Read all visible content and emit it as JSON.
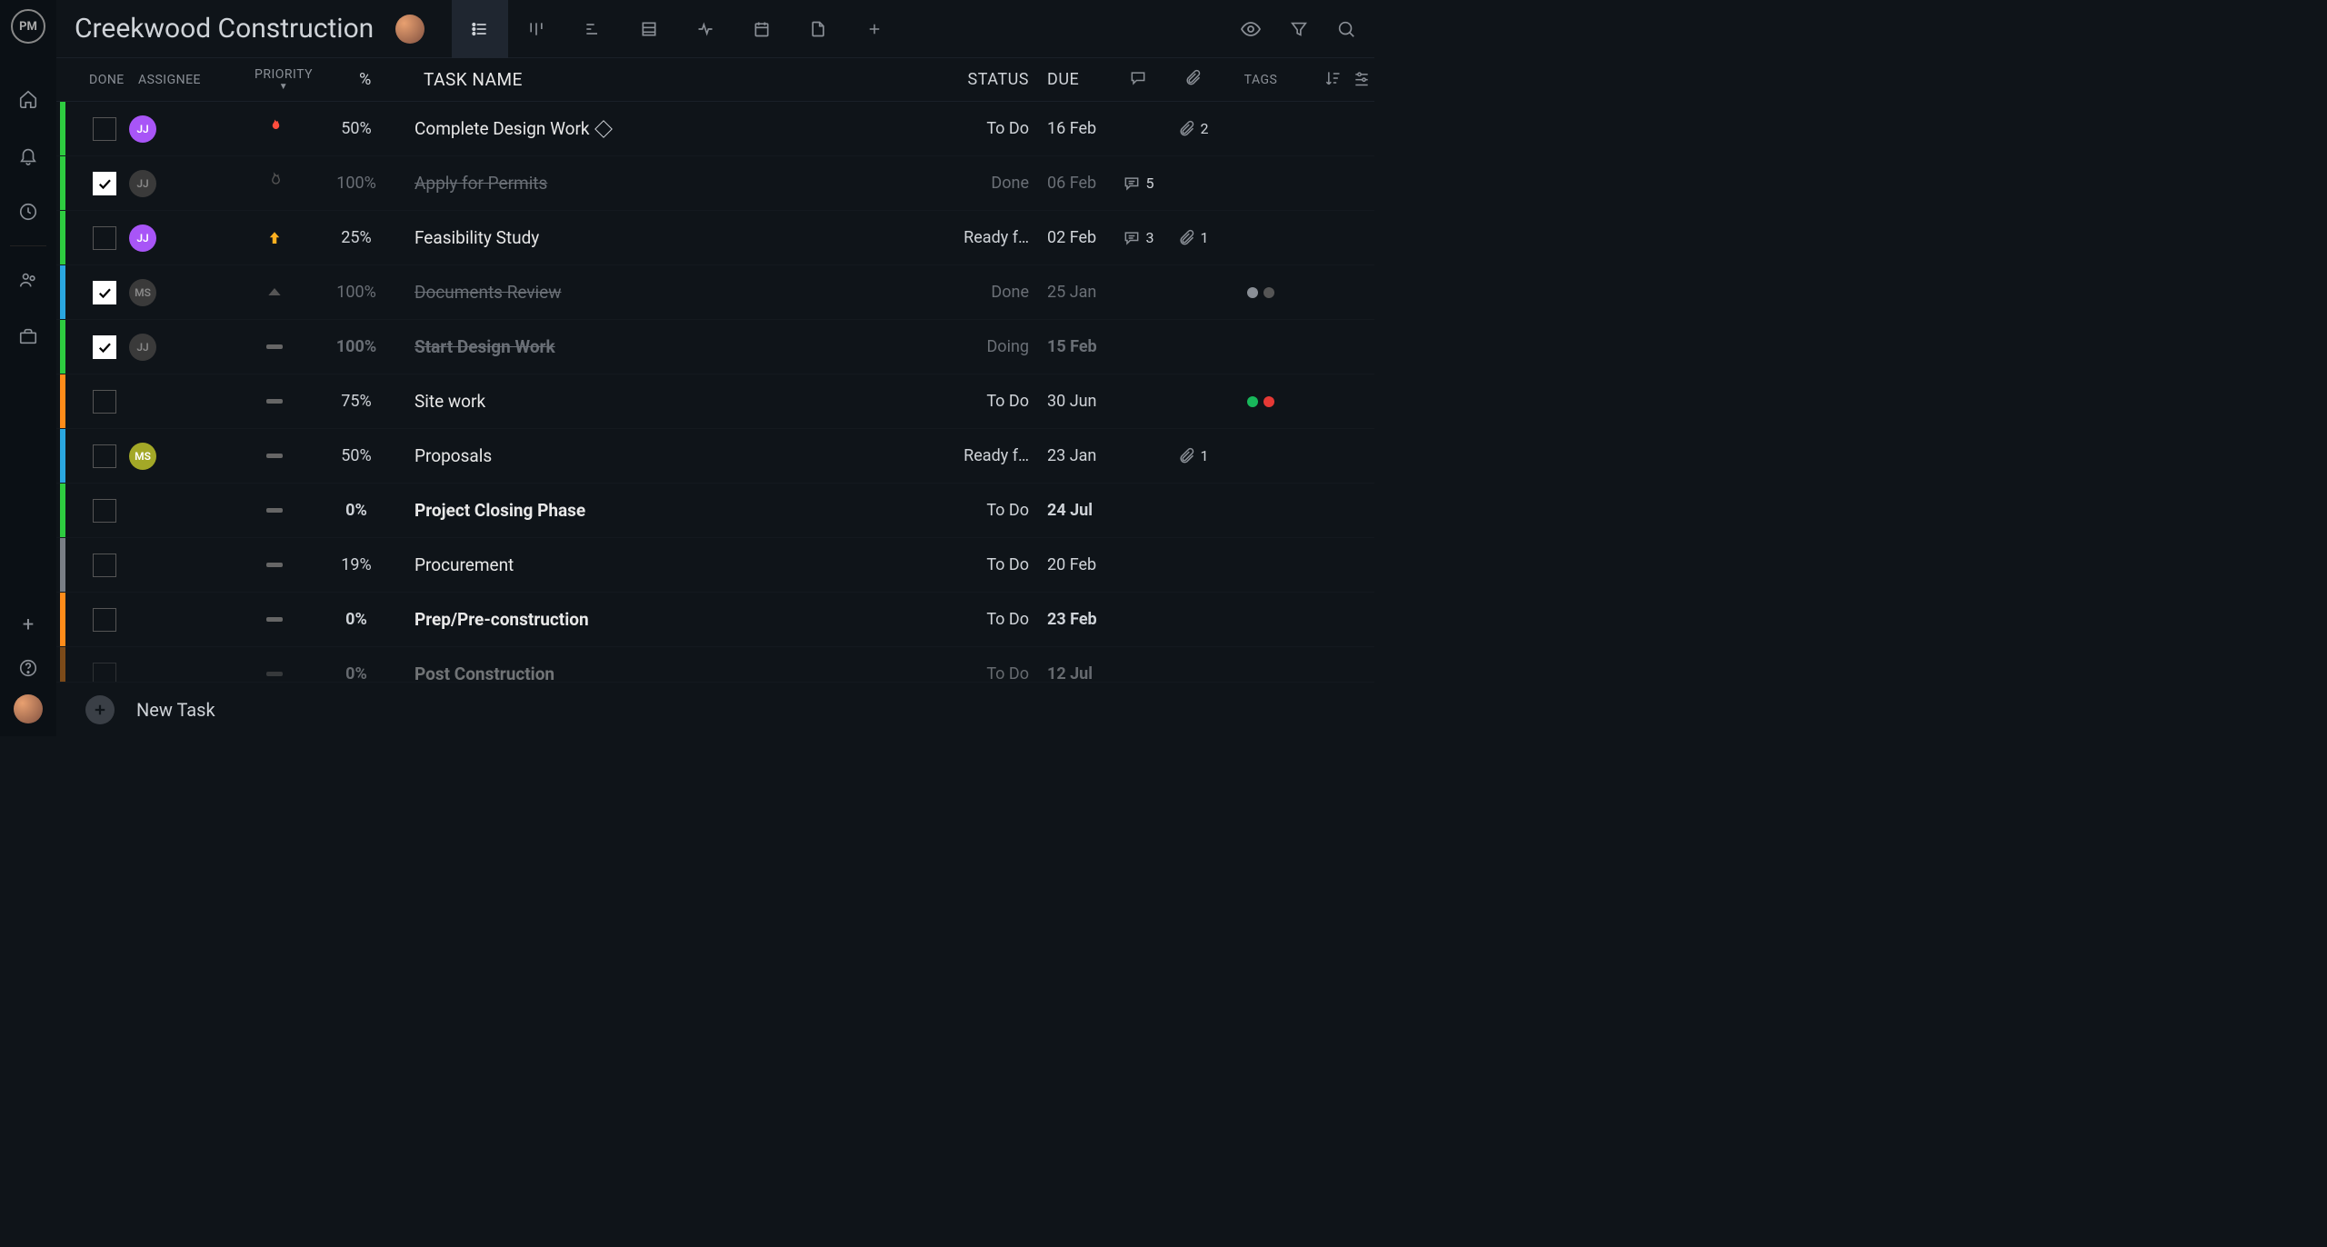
{
  "app": {
    "logo_text": "PM"
  },
  "header": {
    "title": "Creekwood Construction"
  },
  "columns": {
    "done": "DONE",
    "assignee": "ASSIGNEE",
    "priority": "PRIORITY",
    "percent": "%",
    "task_name": "TASK NAME",
    "status": "STATUS",
    "due": "DUE",
    "tags": "TAGS"
  },
  "footer": {
    "new_task": "New Task"
  },
  "stripe_colors": {
    "green": "#2ecc40",
    "blue": "#2aa7e0",
    "orange": "#ff8c1a",
    "grey": "#7a7f86"
  },
  "tasks": [
    {
      "stripe": "green",
      "done": false,
      "assignee": "JJ",
      "assignee_style": "jj",
      "priority": "flame",
      "percent": "50%",
      "name": "Complete Design Work",
      "diamond": true,
      "status": "To Do",
      "due": "16 Feb",
      "comments": null,
      "attachments": "2",
      "tags": [],
      "bold": false
    },
    {
      "stripe": "green",
      "done": true,
      "assignee": "JJ",
      "assignee_style": "jj dim",
      "priority": "flame-dim",
      "percent": "100%",
      "name": "Apply for Permits",
      "diamond": false,
      "status": "Done",
      "due": "06 Feb",
      "comments": "5",
      "attachments": null,
      "tags": [],
      "bold": false
    },
    {
      "stripe": "green",
      "done": false,
      "assignee": "JJ",
      "assignee_style": "jj",
      "priority": "up",
      "percent": "25%",
      "name": "Feasibility Study",
      "diamond": false,
      "status": "Ready f…",
      "due": "02 Feb",
      "comments": "3",
      "attachments": "1",
      "tags": [],
      "bold": false
    },
    {
      "stripe": "blue",
      "done": true,
      "assignee": "MS",
      "assignee_style": "ms",
      "priority": "caret",
      "percent": "100%",
      "name": "Documents Review",
      "diamond": false,
      "status": "Done",
      "due": "25 Jan",
      "comments": null,
      "attachments": null,
      "tags": [
        "#8a8f96",
        "#555"
      ],
      "bold": false
    },
    {
      "stripe": "green",
      "done": true,
      "assignee": "JJ",
      "assignee_style": "jj dim",
      "priority": "dash",
      "percent": "100%",
      "name": "Start Design Work",
      "diamond": false,
      "status": "Doing",
      "due": "15 Feb",
      "comments": null,
      "attachments": null,
      "tags": [],
      "bold": true
    },
    {
      "stripe": "orange",
      "done": false,
      "assignee": "",
      "assignee_style": "",
      "priority": "dash",
      "percent": "75%",
      "name": "Site work",
      "diamond": false,
      "status": "To Do",
      "due": "30 Jun",
      "comments": null,
      "attachments": null,
      "tags": [
        "#18b85b",
        "#e53935"
      ],
      "bold": false
    },
    {
      "stripe": "blue",
      "done": false,
      "assignee": "MS",
      "assignee_style": "ms live",
      "priority": "dash",
      "percent": "50%",
      "name": "Proposals",
      "diamond": false,
      "status": "Ready f…",
      "due": "23 Jan",
      "comments": null,
      "attachments": "1",
      "tags": [],
      "bold": false
    },
    {
      "stripe": "green",
      "done": false,
      "assignee": "",
      "assignee_style": "",
      "priority": "dash",
      "percent": "0%",
      "name": "Project Closing Phase",
      "diamond": false,
      "status": "To Do",
      "due": "24 Jul",
      "comments": null,
      "attachments": null,
      "tags": [],
      "bold": true
    },
    {
      "stripe": "grey",
      "done": false,
      "assignee": "",
      "assignee_style": "",
      "priority": "dash",
      "percent": "19%",
      "name": "Procurement",
      "diamond": false,
      "status": "To Do",
      "due": "20 Feb",
      "comments": null,
      "attachments": null,
      "tags": [],
      "bold": false
    },
    {
      "stripe": "orange",
      "done": false,
      "assignee": "",
      "assignee_style": "",
      "priority": "dash",
      "percent": "0%",
      "name": "Prep/Pre-construction",
      "diamond": false,
      "status": "To Do",
      "due": "23 Feb",
      "comments": null,
      "attachments": null,
      "tags": [],
      "bold": true
    },
    {
      "stripe": "orange",
      "done": false,
      "assignee": "",
      "assignee_style": "",
      "priority": "dash",
      "percent": "0%",
      "name": "Post Construction",
      "diamond": false,
      "status": "To Do",
      "due": "12 Jul",
      "comments": null,
      "attachments": null,
      "tags": [],
      "bold": true,
      "faded": true
    }
  ]
}
